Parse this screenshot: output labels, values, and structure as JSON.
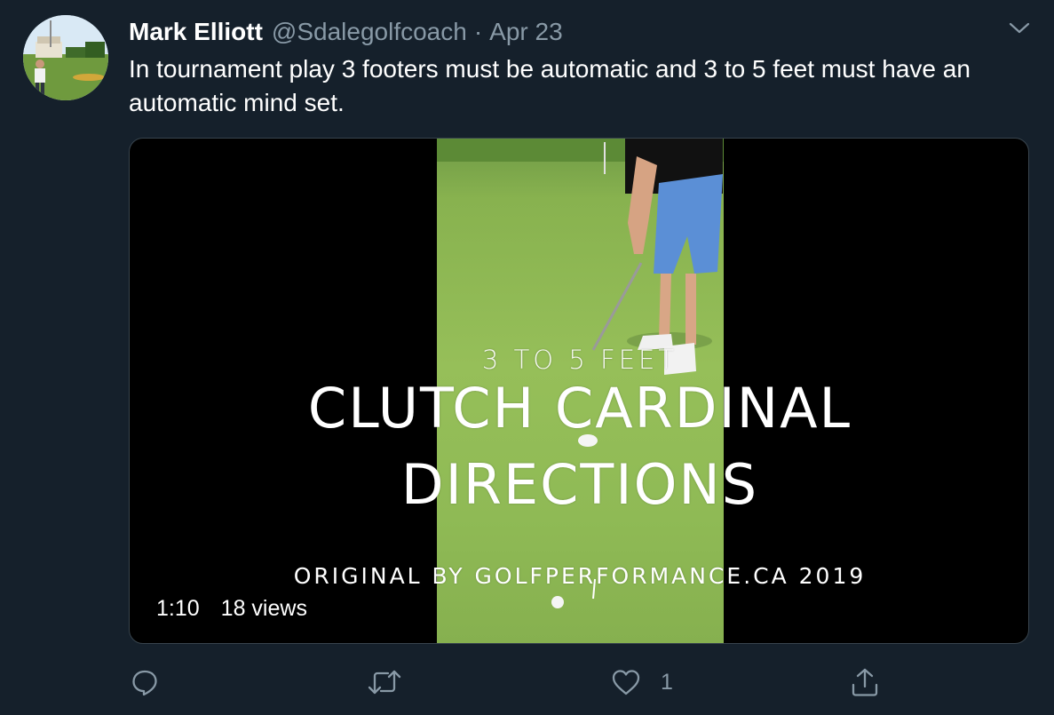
{
  "tweet": {
    "display_name": "Mark Elliott",
    "handle": "@Sdalegolfcoach",
    "separator": "·",
    "date": "Apr 23",
    "text": "In tournament play 3 footers must be automatic and 3 to 5 feet must have an automatic mind set."
  },
  "video": {
    "overlay_small": "3 TO 5 FEET",
    "overlay_line1": "CLUTCH CARDINAL",
    "overlay_line2": "DIRECTIONS",
    "overlay_credit": "ORIGINAL BY GOLFPERFORMANCE.CA 2019",
    "duration": "1:10",
    "views": "18 views"
  },
  "actions": {
    "reply_icon": "reply-icon",
    "retweet_icon": "retweet-icon",
    "like_icon": "heart-icon",
    "like_count": "1",
    "share_icon": "share-icon"
  },
  "colors": {
    "background": "#15202b",
    "secondary_text": "#8899a6",
    "border": "#38444d"
  }
}
